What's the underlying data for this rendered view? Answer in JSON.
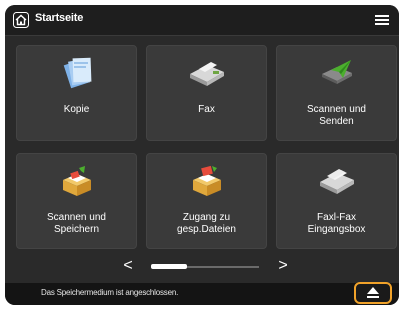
{
  "header": {
    "title": "Startseite",
    "home_icon": "home-icon",
    "menu_icon": "hamburger-menu-icon"
  },
  "tiles": [
    {
      "label": "Kopie",
      "icon": "copy-icon"
    },
    {
      "label": "Fax",
      "icon": "fax-icon"
    },
    {
      "label": "Scannen und\nSenden",
      "icon": "scan-send-icon"
    },
    {
      "label": "Scannen und\nSpeichern",
      "icon": "scan-store-icon"
    },
    {
      "label": "Zugang zu\ngesp.Dateien",
      "icon": "stored-files-icon"
    },
    {
      "label": "Faxl-Fax\nEingangsbox",
      "icon": "fax-inbox-icon"
    }
  ],
  "pager": {
    "prev_glyph": "<",
    "next_glyph": ">",
    "page_indicator_fraction": 0.33
  },
  "status": {
    "message": "Das Speichermedium ist angeschlossen.",
    "eject_icon": "eject-icon"
  },
  "colors": {
    "background": "#2a2a2a",
    "tile": "#3a3a3a",
    "highlight": "#f0a22a"
  }
}
